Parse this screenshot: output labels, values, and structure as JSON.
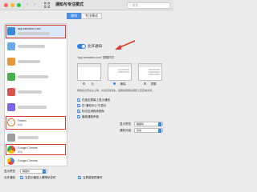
{
  "window": {
    "title": "通知与专注模式",
    "search_placeholder": "搜索",
    "back_glyph": "‹",
    "forward_glyph": "›",
    "traffic_lights": [
      "#fe5f57",
      "#febc2e",
      "#28c840"
    ]
  },
  "tabs": [
    {
      "label": "通知",
      "active": true
    },
    {
      "label": "专注模式",
      "active": false
    }
  ],
  "app_list": {
    "items": [
      {
        "label": "app.asmotion.com",
        "sublabel": "",
        "icon_color": "#3a86d6",
        "selected": true,
        "highlighted": true
      },
      {
        "label": "",
        "sublabel": "",
        "icon_color": "#6aa9e8",
        "selected": false,
        "highlighted": false
      },
      {
        "label": "",
        "sublabel": "",
        "icon_color": "#e8963a",
        "selected": false,
        "highlighted": false
      },
      {
        "label": "",
        "sublabel": "",
        "icon_color": "#48b04d",
        "selected": false,
        "highlighted": false
      },
      {
        "label": "",
        "sublabel": "",
        "icon_color": "#d9534f",
        "selected": false,
        "highlighted": false
      },
      {
        "label": "",
        "sublabel": "",
        "icon_color": "#7b68ee",
        "selected": false,
        "highlighted": false
      },
      {
        "label": "Firefox",
        "sublabel": "横幅",
        "icon_color": "#e66000",
        "selected": false,
        "highlighted": true
      },
      {
        "label": "",
        "sublabel": "",
        "icon_color": "#9e9e9e",
        "selected": false,
        "highlighted": false
      },
      {
        "label": "Google Chrome",
        "sublabel": "横幅",
        "icon_color": "#34a853",
        "selected": false,
        "highlighted": true
      },
      {
        "label": "Google Chrome",
        "sublabel": "",
        "icon_color": "#4285f4",
        "selected": false,
        "highlighted": false
      }
    ]
  },
  "detail": {
    "allow_notifications_label": "允许通知",
    "alert_style_label": "\"app.asmotion.com\" 提醒样式:",
    "styles": [
      {
        "name": "无",
        "selected": false
      },
      {
        "name": "横幅",
        "selected": true
      },
      {
        "name": "提醒",
        "selected": false
      }
    ],
    "style_note": "横幅会出现在右上角，并会自动消失。提醒会保留在屏幕上直至被关闭。",
    "checkboxes": [
      {
        "label": "在锁定屏幕上显示通知",
        "checked": true
      },
      {
        "label": "在\"通知中心\"中显示",
        "checked": true
      }
    ],
    "badge_label": "标记应用程序图标",
    "sound_label": "播放通知声音",
    "grouping_label": "通知分组",
    "grouping_value": "自动",
    "preview_label": "显示预览",
    "preview_value": "解锁时"
  },
  "bottom": {
    "show_preview_label": "显示预览",
    "show_preview_value": "解锁时",
    "allow_label": "允许通知",
    "option1": "当显示器进入睡眠状态时",
    "option2": "当屏幕被镜像时"
  }
}
